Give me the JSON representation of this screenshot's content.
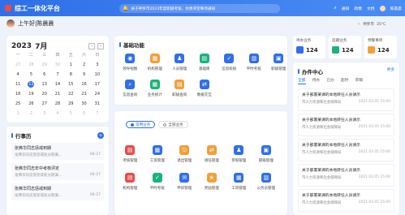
{
  "header": {
    "title": "综工一体化平台",
    "notice": "关于神罗市2023年度职级考核，优秀评定事项通知",
    "nav": [
      "通知",
      "政策",
      "文档"
    ],
    "user": "陈晨晨"
  },
  "greeting": "上午好|陈晨晨",
  "calendar": {
    "year": "2023",
    "month": "7月",
    "weekdays": [
      "一",
      "二",
      "三",
      "四",
      "五",
      "六",
      "日"
    ],
    "days": [
      [
        "27",
        "28",
        "29",
        "30",
        "1",
        "2",
        "3"
      ],
      [
        "4",
        "5",
        "6",
        "7",
        "8",
        "9",
        "10"
      ],
      [
        "11",
        "12",
        "13",
        "14",
        "15",
        "16",
        "17"
      ],
      [
        "18",
        "19",
        "20",
        "21",
        "22",
        "23",
        "24"
      ],
      [
        "25",
        "26",
        "27",
        "28",
        "29",
        "30",
        "31"
      ],
      [
        "1",
        "2",
        "3",
        "4",
        "5",
        "6",
        "7"
      ]
    ],
    "today": "12"
  },
  "schedule": {
    "title": "行事历",
    "items": [
      {
        "title": "张弗华同志惩戒到期",
        "desc": "张弗华同志受惩戒处分期满...",
        "date": "06-27"
      },
      {
        "title": "张弗华同志年中考核评定",
        "desc": "张弗华同志受惩戒处分期满...",
        "date": "06-27"
      },
      {
        "title": "张弗华同志惩戒到期",
        "desc": "张弗华同志受惩戒处分期满...",
        "date": "06-27"
      }
    ]
  },
  "functions": {
    "title": "基础功能",
    "items": [
      "领导视图",
      "机构管理",
      "人员管理",
      "基础库",
      "信息校核",
      "平时考核",
      "职级管理",
      "信息查询",
      "业务统计",
      "职级查询",
      "数据交互"
    ]
  },
  "business": {
    "tab_common": "常用业务",
    "tab_all": "全部业务",
    "items": [
      "考核管理",
      "工资管理",
      "退出管理",
      "调任管理",
      "参照管理",
      "职级管理",
      "机构管理",
      "平时考核",
      "申诉管理",
      "奖励管理",
      "工资管理",
      "公务员管理"
    ]
  },
  "stats": [
    {
      "label": "待办业务",
      "value": "124"
    },
    {
      "label": "追期业务",
      "value": "124"
    },
    {
      "label": "预警事项",
      "value": "124"
    }
  ],
  "weather": {
    "city": "神罗市",
    "temp": "35°C"
  },
  "office": {
    "title": "办件中心",
    "more": "更多",
    "tabs": [
      "全部",
      "待办",
      "已办",
      "超时",
      "草稿"
    ],
    "items": [
      {
        "title": "关于部署某课的本地转任人员请示",
        "sub": "市人力资源和社会保障局",
        "date": "2021.03.05 15:00"
      },
      {
        "title": "关于部署某课的本地转任人员请示",
        "sub": "市人力资源和社会保障局",
        "date": "2021.03.05 15:00"
      },
      {
        "title": "关于部署某课的本地转任人员请示",
        "sub": "市人力资源和社会保障局",
        "date": "2021.03.05 15:00"
      },
      {
        "title": "关于部署某课的本地转任人员请示",
        "sub": "市人力资源和社会保障局",
        "date": "2021.03.05 15:00"
      },
      {
        "title": "关于部署某课的本地转任人员请示",
        "sub": "市人力资源和社会保障局",
        "date": "2021.03.05 15:00"
      }
    ]
  }
}
